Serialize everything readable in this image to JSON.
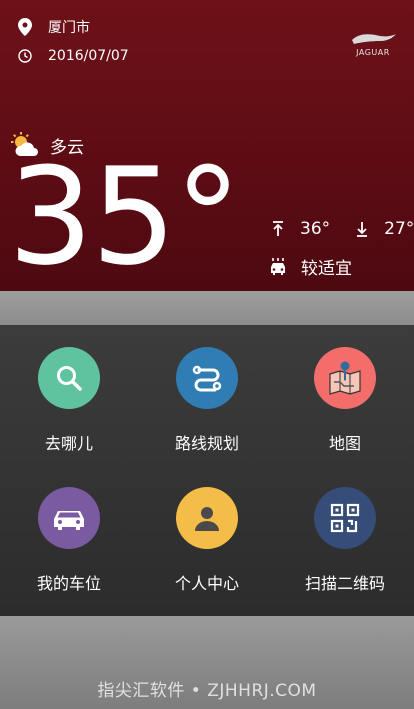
{
  "header": {
    "location": {
      "text": "厦门市",
      "icon": "location-pin-icon"
    },
    "date": {
      "text": "2016/07/07",
      "icon": "clock-icon"
    },
    "brand": {
      "text": "JAGUAR",
      "icon": "jaguar-logo"
    }
  },
  "weather": {
    "condition": "多云",
    "condition_icon": "partly-cloudy-icon",
    "temperature": "35°",
    "high": "36°",
    "low": "27°",
    "car_wash": "较适宜",
    "colors": {
      "header_bg": "#6e1119"
    }
  },
  "menu": {
    "items": [
      {
        "label": "去哪儿",
        "icon": "search-icon",
        "color": "#5fc3a0"
      },
      {
        "label": "路线规划",
        "icon": "route-icon",
        "color": "#2f7db2"
      },
      {
        "label": "地图",
        "icon": "map-icon",
        "color": "#f36d6a"
      },
      {
        "label": "我的车位",
        "icon": "car-icon",
        "color": "#7a5aa0"
      },
      {
        "label": "个人中心",
        "icon": "person-icon",
        "color": "#f3bd48"
      },
      {
        "label": "扫描二维码",
        "icon": "qr-code-icon",
        "color": "#354d78"
      }
    ]
  },
  "watermark": "指尖汇软件 • ZJHHRJ.COM"
}
